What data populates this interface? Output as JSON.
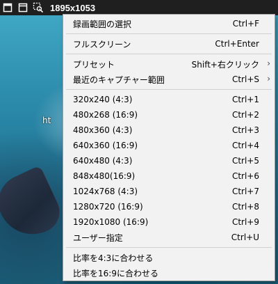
{
  "titlebar": {
    "title": "1895x1053",
    "icons": [
      "fullscreen-icon",
      "window-icon",
      "region-select-icon"
    ]
  },
  "background": {
    "partial_text": "ht"
  },
  "menu": {
    "items": [
      {
        "label": "録画範囲の選択",
        "shortcut": "Ctrl+F"
      },
      {
        "label": "フルスクリーン",
        "shortcut": "Ctrl+Enter"
      },
      {
        "label": "プリセット",
        "shortcut": "Shift+右クリック"
      },
      {
        "label": "最近のキャプチャー範囲",
        "shortcut": "Ctrl+S"
      },
      {
        "label": "320x240 (4:3)",
        "shortcut": "Ctrl+1"
      },
      {
        "label": "480x268 (16:9)",
        "shortcut": "Ctrl+2"
      },
      {
        "label": "480x360 (4:3)",
        "shortcut": "Ctrl+3"
      },
      {
        "label": "640x360 (16:9)",
        "shortcut": "Ctrl+4"
      },
      {
        "label": "640x480 (4:3)",
        "shortcut": "Ctrl+5"
      },
      {
        "label": "848x480(16:9)",
        "shortcut": "Ctrl+6"
      },
      {
        "label": "1024x768 (4:3)",
        "shortcut": "Ctrl+7"
      },
      {
        "label": "1280x720 (16:9)",
        "shortcut": "Ctrl+8"
      },
      {
        "label": "1920x1080 (16:9)",
        "shortcut": "Ctrl+9"
      },
      {
        "label": "ユーザー指定",
        "shortcut": "Ctrl+U"
      },
      {
        "label": "比率を4:3に合わせる",
        "shortcut": ""
      },
      {
        "label": "比率を16:9に合わせる",
        "shortcut": ""
      }
    ]
  }
}
